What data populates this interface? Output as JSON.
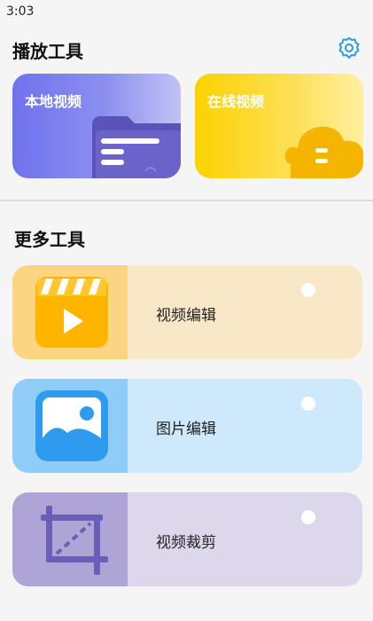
{
  "status_bar": {
    "time": "3:03"
  },
  "play_tools": {
    "title": "播放工具",
    "settings_icon": "gear-icon",
    "cards": [
      {
        "label": "本地视频",
        "icon": "folder-icon"
      },
      {
        "label": "在线视频",
        "icon": "cloud-icon"
      }
    ]
  },
  "more_tools": {
    "title": "更多工具",
    "items": [
      {
        "label": "视频编辑",
        "icon": "video-clapper-icon"
      },
      {
        "label": "图片编辑",
        "icon": "image-icon"
      },
      {
        "label": "视频裁剪",
        "icon": "crop-icon"
      }
    ]
  },
  "colors": {
    "accent": "#2b9fd8",
    "local_card": "#7376ee",
    "online_card": "#fcd200",
    "video_edit": "#fbd582",
    "image_edit": "#8fcdf8",
    "video_crop": "#aea5d6"
  }
}
